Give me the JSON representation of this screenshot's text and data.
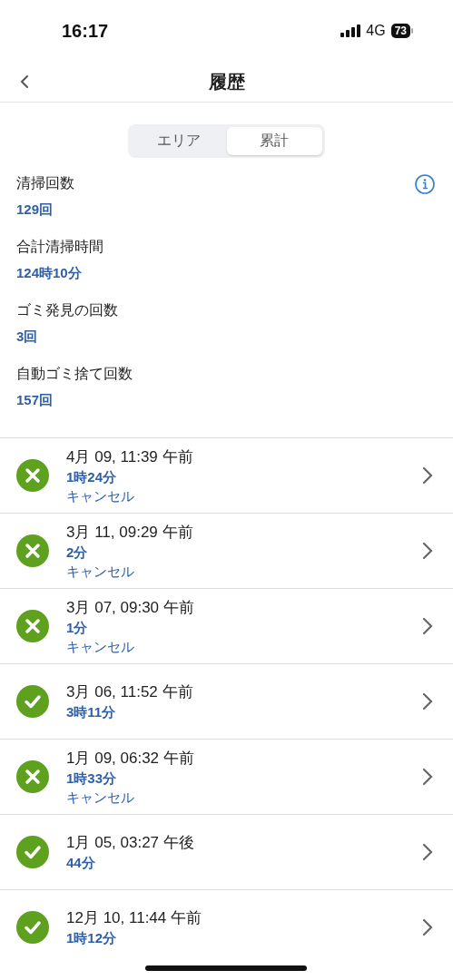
{
  "status_bar": {
    "time": "16:17",
    "network": "4G",
    "battery": "73"
  },
  "nav": {
    "title": "履歴"
  },
  "tabs": [
    {
      "label": "エリア",
      "selected": false
    },
    {
      "label": "累計",
      "selected": true
    }
  ],
  "stats": [
    {
      "label": "清掃回数",
      "value": "129回"
    },
    {
      "label": "合計清掃時間",
      "value": "124時10分"
    },
    {
      "label": "ゴミ発見の回数",
      "value": "3回"
    },
    {
      "label": "自動ゴミ捨て回数",
      "value": "157回"
    }
  ],
  "history": [
    {
      "kind": "cancelled",
      "date": "4月 09, 11:39 午前",
      "duration": "1時24分",
      "note": "キャンセル"
    },
    {
      "kind": "cancelled",
      "date": "3月 11, 09:29 午前",
      "duration": "2分",
      "note": "キャンセル"
    },
    {
      "kind": "cancelled",
      "date": "3月 07, 09:30 午前",
      "duration": "1分",
      "note": "キャンセル"
    },
    {
      "kind": "completed",
      "date": "3月 06, 11:52 午前",
      "duration": "3時11分"
    },
    {
      "kind": "cancelled",
      "date": "1月 09, 06:32 午前",
      "duration": "1時33分",
      "note": "キャンセル"
    },
    {
      "kind": "completed",
      "date": "1月 05, 03:27 午後",
      "duration": "44分"
    },
    {
      "kind": "completed",
      "date": "12月 10, 11:44 午前",
      "duration": "1時12分"
    }
  ]
}
